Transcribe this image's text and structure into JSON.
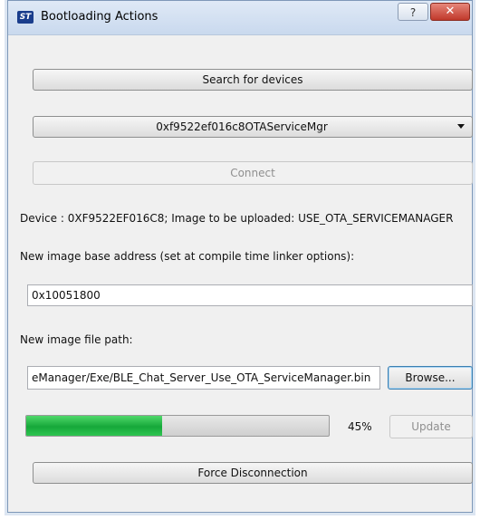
{
  "window": {
    "title": "Bootloading Actions",
    "logo_text": "ST",
    "help_label": "?",
    "close_label": "✕"
  },
  "search_button_label": "Search for devices",
  "device_select": {
    "selected": "0xf9522ef016c8OTAServiceMgr"
  },
  "connect_button_label": "Connect",
  "device_info": "Device : 0XF9522EF016C8; Image to be uploaded: USE_OTA_SERVICEMANAGER",
  "base_address": {
    "label": "New image base address (set at compile time linker options):",
    "value": "0x10051800"
  },
  "file_path": {
    "label": "New image file path:",
    "value": "eManager/Exe/BLE_Chat_Server_Use_OTA_ServiceManager.bin"
  },
  "browse_button_label": "Browse...",
  "progress": {
    "fraction": 0.45,
    "percent_text": "45%"
  },
  "update_button_label": "Update",
  "force_disconnect_label": "Force Disconnection",
  "colors": {
    "progress_green": "#16a83a",
    "close_red": "#c0392b"
  }
}
